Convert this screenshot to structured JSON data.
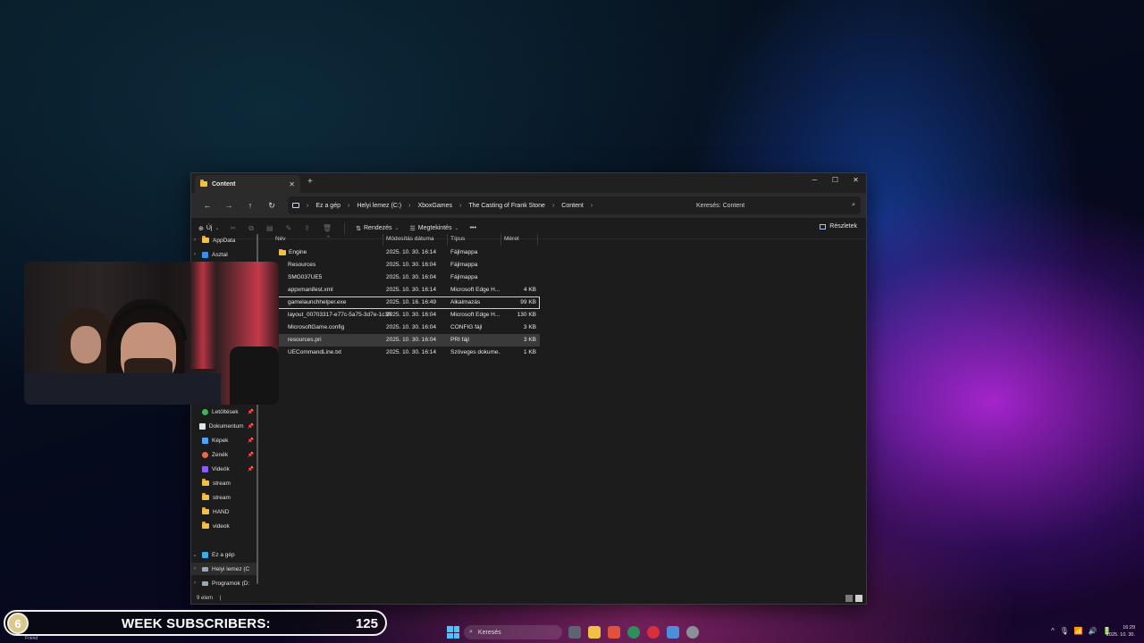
{
  "window": {
    "tab_title": "Content",
    "close_tab": "✕",
    "new_tab": "+",
    "controls": {
      "minimize": "─",
      "maximize": "☐",
      "close": "✕"
    }
  },
  "nav": {
    "back": "←",
    "forward": "→",
    "up": "↑",
    "refresh": "↻",
    "breadcrumb": [
      "Ez a gép",
      "Helyi lemez (C:)",
      "XboxGames",
      "The Casting of Frank Stone",
      "Content"
    ],
    "separator": "›",
    "search_placeholder": "Keresés: Content",
    "search_icon": "⌕"
  },
  "commandbar": {
    "new_label": "Új",
    "sort_label": "Rendezés",
    "view_label": "Megtekintés",
    "more_label": "•••",
    "details_label": "Részletek"
  },
  "sidebar": {
    "top_items": [
      {
        "label": "AppData",
        "icon": "folder-icon"
      },
      {
        "label": "Asztal",
        "icon": "desktop-icon"
      }
    ],
    "quick_items": [
      {
        "label": "Letöltések",
        "icon": "download-icon"
      },
      {
        "label": "Dokumentum",
        "icon": "document-icon"
      },
      {
        "label": "Képek",
        "icon": "pictures-icon"
      },
      {
        "label": "Zenék",
        "icon": "music-icon"
      },
      {
        "label": "Videók",
        "icon": "video-icon"
      },
      {
        "label": "stream",
        "icon": "folder-icon"
      },
      {
        "label": "stream",
        "icon": "folder-icon"
      },
      {
        "label": "HAND",
        "icon": "folder-icon"
      },
      {
        "label": "videok",
        "icon": "folder-icon"
      }
    ],
    "this_pc": "Ez a gép",
    "drives": [
      {
        "label": "Helyi lemez (C",
        "icon": "drive-icon"
      },
      {
        "label": "Programok (D:",
        "icon": "drive-icon"
      }
    ]
  },
  "filelist": {
    "columns": {
      "name": "Név",
      "date": "Módosítás dátuma",
      "type": "Típus",
      "size": "Méret"
    },
    "rows": [
      {
        "name": "Engine",
        "date": "2025. 10. 30. 16:14",
        "type": "Fájlmappa",
        "size": "",
        "folder": true
      },
      {
        "name": "Resources",
        "date": "2025. 10. 30. 16:04",
        "type": "Fájlmappa",
        "size": "",
        "folder": true
      },
      {
        "name": "SMG037UE5",
        "date": "2025. 10. 30. 16:04",
        "type": "Fájlmappa",
        "size": "",
        "folder": false
      },
      {
        "name": "appxmanifest.xml",
        "date": "2025. 10. 30. 16:14",
        "type": "Microsoft Edge H...",
        "size": "4 KB",
        "folder": false
      },
      {
        "name": "gamelaunchhelper.exe",
        "date": "2025. 10. 16. 16:49",
        "type": "Alkalmazás",
        "size": "99 KB",
        "folder": false
      },
      {
        "name": "layout_00703317-e77c-5a75-3d7e-1c3f96f...",
        "date": "2025. 10. 30. 16:04",
        "type": "Microsoft Edge H...",
        "size": "130 KB",
        "folder": false
      },
      {
        "name": "MicrosoftGame.config",
        "date": "2025. 10. 30. 16:04",
        "type": "CONFIG fájl",
        "size": "3 KB",
        "folder": false
      },
      {
        "name": "resources.pri",
        "date": "2025. 10. 30. 16:04",
        "type": "PRI fájl",
        "size": "3 KB",
        "folder": false
      },
      {
        "name": "UECommandLine.txt",
        "date": "2025. 10. 30. 16:14",
        "type": "Szöveges dokume...",
        "size": "1 KB",
        "folder": false
      }
    ]
  },
  "status": {
    "count": "9 elem",
    "cursor": "|"
  },
  "banner": {
    "badge": "6",
    "label": "WEEK SUBSCRIBERS:",
    "count": "125",
    "sub": "Friend"
  },
  "taskbar": {
    "search_label": "Keresés",
    "search_icon": "⌕",
    "tray": [
      "^",
      "🎙",
      "📶",
      "🔊",
      "🔋"
    ],
    "time": "16:29",
    "date": "2025. 10. 30."
  },
  "colors": {
    "folder": "#f2c044",
    "window_bg": "#1c1c1c",
    "accent": "#4cc2ff",
    "banner_badge": "#d9c98e"
  }
}
